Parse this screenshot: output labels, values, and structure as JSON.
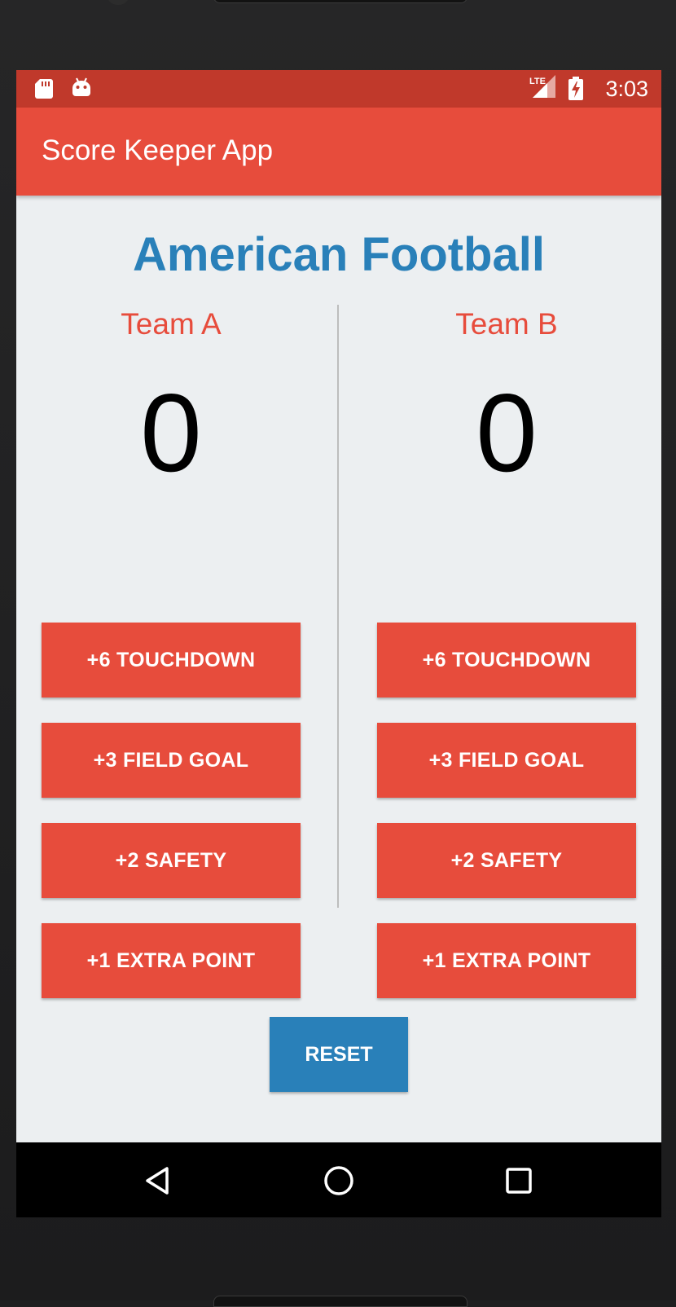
{
  "status_bar": {
    "time": "3:03",
    "network": "LTE",
    "icons": [
      "sd-card-icon",
      "android-icon",
      "lte-signal-icon",
      "battery-charging-icon"
    ]
  },
  "app_bar": {
    "title": "Score Keeper App"
  },
  "main": {
    "game_title": "American Football",
    "teams": [
      {
        "name": "Team A",
        "score": "0",
        "buttons": [
          "+6 TOUCHDOWN",
          "+3 FIELD GOAL",
          "+2 SAFETY",
          "+1 EXTRA POINT"
        ]
      },
      {
        "name": "Team B",
        "score": "0",
        "buttons": [
          "+6 TOUCHDOWN",
          "+3 FIELD GOAL",
          "+2 SAFETY",
          "+1 EXTRA POINT"
        ]
      }
    ],
    "reset_label": "RESET"
  },
  "nav_bar": {
    "icons": [
      "back-icon",
      "home-icon",
      "recents-icon"
    ]
  },
  "colors": {
    "primary": "#e74c3c",
    "primary_dark": "#c0392b",
    "accent": "#2980b9",
    "background": "#eceff1"
  }
}
